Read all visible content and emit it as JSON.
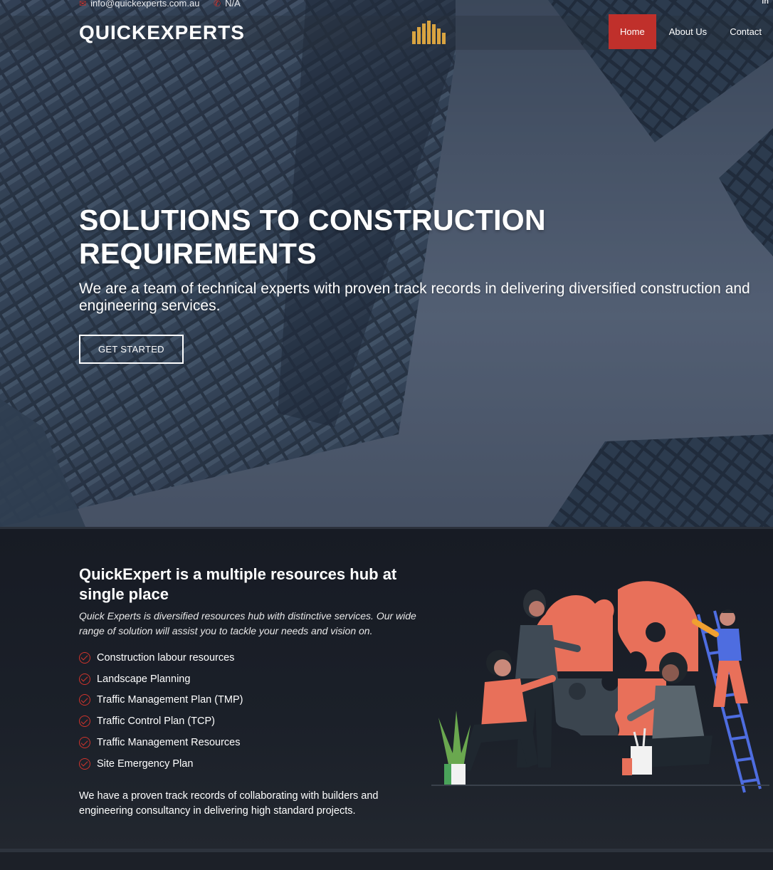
{
  "topbar": {
    "email": "info@quickexperts.com.au",
    "phone": "N/A",
    "social": "in"
  },
  "header": {
    "logo": "QUICKEXPERTS",
    "nav": [
      {
        "label": "Home",
        "active": true
      },
      {
        "label": "About Us",
        "active": false
      },
      {
        "label": "Contact",
        "active": false
      }
    ]
  },
  "hero": {
    "title": "SOLUTIONS TO CONSTRUCTION REQUIREMENTS",
    "subtitle": "We are a team of technical experts with proven track records in delivering diversified construction and engineering services.",
    "cta": "GET STARTED"
  },
  "features": {
    "title": "QuickExpert is a multiple resources hub at single place",
    "description": "Quick Experts is diversified resources hub with distinctive services. Our wide range of solution will assist you to tackle your needs and vision on.",
    "items": [
      "Construction labour resources",
      "Landscape Planning",
      "Traffic Management Plan (TMP)",
      "Traffic Control Plan (TCP)",
      "Traffic Management Resources",
      "Site Emergency Plan"
    ],
    "footer": "We have a proven track records of collaborating with builders and engineering consultancy in delivering high standard projects."
  },
  "colors": {
    "accent": "#c0302b",
    "logo_mark": "#d9a441",
    "puzzle": "#e8705a"
  },
  "icons": {
    "email": "envelope-icon",
    "phone": "phone-icon",
    "social": "linkedin-icon",
    "list": "check-circle-icon"
  }
}
